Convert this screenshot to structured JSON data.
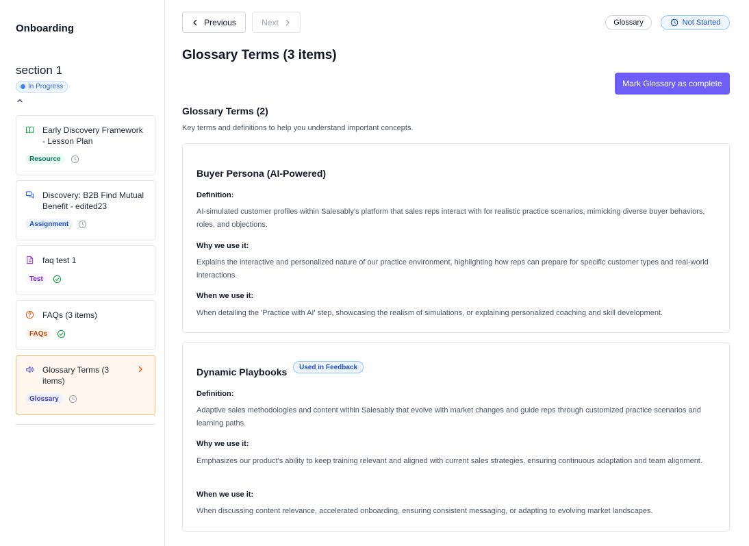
{
  "sidebar": {
    "app_title": "Onboarding",
    "section_title": "section 1",
    "section_status": "In Progress",
    "items": [
      {
        "title": "Early Discovery Framework - Lesson Plan",
        "tag": "Resource",
        "icon": "book-open-icon",
        "state": "clock-icon"
      },
      {
        "title": "Discovery: B2B Find Mutual Benefit - edited23",
        "tag": "Assignment",
        "icon": "chat-bubbles-icon",
        "state": "clock-icon"
      },
      {
        "title": "faq test 1",
        "tag": "Test",
        "icon": "document-icon",
        "state": "check-circle-icon"
      },
      {
        "title": "FAQs (3 items)",
        "tag": "FAQs",
        "icon": "question-circle-icon",
        "state": "check-circle-icon"
      },
      {
        "title": "Glossary Terms (3 items)",
        "tag": "Glossary",
        "icon": "speaker-icon",
        "state": "clock-icon",
        "active": true
      }
    ]
  },
  "toolbar": {
    "previous_label": "Previous",
    "next_label": "Next",
    "type_pill": "Glossary",
    "status_pill": "Not Started"
  },
  "main": {
    "page_title": "Glossary Terms (3 items)",
    "complete_button": "Mark Glossary as complete",
    "section_heading": "Glossary Terms (2)",
    "section_description": "Key terms and definitions to help you understand important concepts.",
    "terms": [
      {
        "name": "Buyer Persona (AI-Powered)",
        "badge": "",
        "definition_label": "Definition:",
        "definition": "AI-simulated customer profiles within Salesably's platform that sales reps interact with for realistic practice scenarios, mimicking diverse buyer behaviors, roles, and objections.",
        "why_label": "Why we use it:",
        "why": "Explains the interactive and personalized nature of our practice environment, highlighting how reps can prepare for specific customer types and real-world interactions.",
        "when_label": "When we use it:",
        "when": "When detailing the 'Practice with AI' step, showcasing the realism of simulations, or explaining personalized coaching and skill development."
      },
      {
        "name": "Dynamic Playbooks",
        "badge": "Used in Feedback",
        "definition_label": "Definition:",
        "definition": "Adaptive sales methodologies and content within Salesably that evolve with market changes and guide reps through customized practice scenarios and learning paths.",
        "why_label": "Why we use it:",
        "why": "Emphasizes our product's ability to keep training relevant and aligned with current sales strategies, ensuring continuous adaptation and team alignment.",
        "when_label": "When we use it:",
        "when": "When discussing content relevance, accelerated onboarding, ensuring consistent messaging, or adapting to evolving market landscapes."
      }
    ]
  },
  "colors": {
    "accent": "#6d5ef7",
    "active_card_bg": "#fff7ed",
    "active_card_border": "#fdba74",
    "status_blue": "#1d4ed8"
  }
}
